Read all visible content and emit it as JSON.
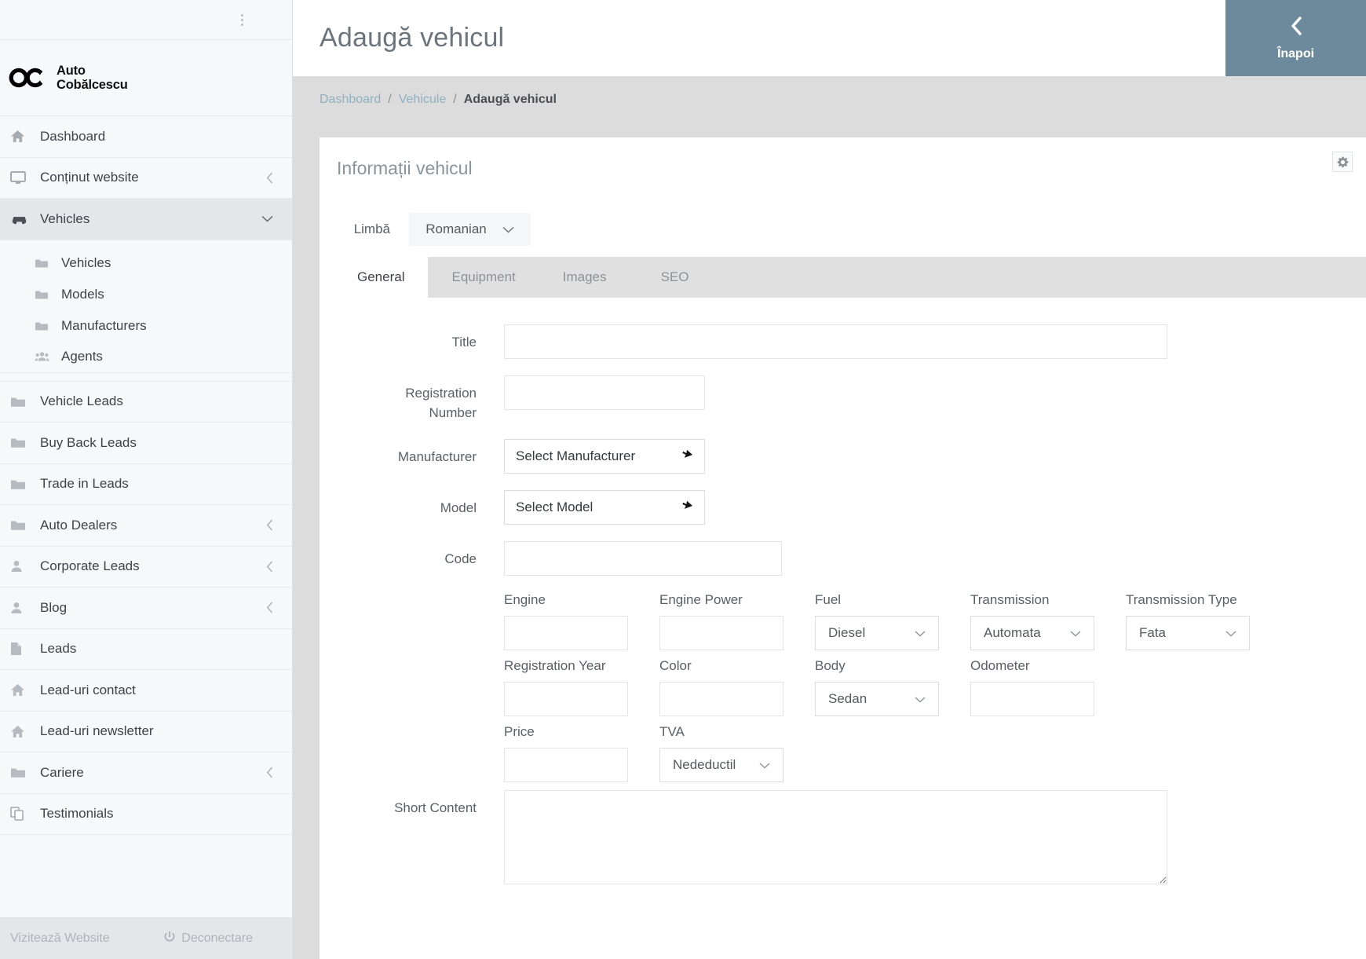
{
  "brand": {
    "line1": "Auto",
    "line2": "Cobălcescu",
    "logo_icon": "ac-monogram-logo"
  },
  "sidebar": {
    "kebab_icon": "kebab-menu-icon",
    "items": [
      {
        "label": "Dashboard",
        "icon": "home-icon",
        "caret": "",
        "active": false
      },
      {
        "label": "Conținut website",
        "icon": "monitor-icon",
        "caret": "‹",
        "active": false
      },
      {
        "label": "Vehicles",
        "icon": "car-icon",
        "caret": "⌄",
        "active": true
      },
      {
        "label": "Vehicle Leads",
        "icon": "folder-icon",
        "caret": "",
        "active": false
      },
      {
        "label": "Buy Back Leads",
        "icon": "folder-icon",
        "caret": "",
        "active": false
      },
      {
        "label": "Trade in Leads",
        "icon": "folder-icon",
        "caret": "",
        "active": false
      },
      {
        "label": "Auto Dealers",
        "icon": "folder-icon",
        "caret": "‹",
        "active": false
      },
      {
        "label": "Corporate Leads",
        "icon": "user-icon",
        "caret": "‹",
        "active": false
      },
      {
        "label": "Blog",
        "icon": "user-icon",
        "caret": "‹",
        "active": false
      },
      {
        "label": "Leads",
        "icon": "file-icon",
        "caret": "",
        "active": false
      },
      {
        "label": "Lead-uri contact",
        "icon": "home-icon",
        "caret": "",
        "active": false
      },
      {
        "label": "Lead-uri newsletter",
        "icon": "home-icon",
        "caret": "",
        "active": false
      },
      {
        "label": "Cariere",
        "icon": "folder-icon",
        "caret": "‹",
        "active": false
      },
      {
        "label": "Testimonials",
        "icon": "copy-icon",
        "caret": "",
        "active": false
      }
    ],
    "subitems": [
      {
        "label": "Vehicles",
        "icon": "folder-icon"
      },
      {
        "label": "Models",
        "icon": "folder-icon"
      },
      {
        "label": "Manufacturers",
        "icon": "folder-icon"
      },
      {
        "label": "Agents",
        "icon": "users-icon"
      }
    ],
    "footer": {
      "visit_site": "Vizitează Website",
      "logout": "Deconectare",
      "logout_icon": "power-icon"
    }
  },
  "header": {
    "title": "Adaugă vehicul",
    "back_label": "Înapoi",
    "back_icon": "chevron-left-icon",
    "back_color": "#6c8a9c"
  },
  "breadcrumb": {
    "items": [
      "Dashboard",
      "Vehicule",
      "Adaugă vehicul"
    ],
    "separator": "/"
  },
  "card": {
    "title": "Informații vehicul",
    "gear_icon": "gear-icon",
    "language": {
      "label": "Limbă",
      "value": "Romanian",
      "chevron_icon": "chevron-down-icon"
    },
    "tabs": [
      {
        "label": "General",
        "active": true
      },
      {
        "label": "Equipment",
        "active": false
      },
      {
        "label": "Images",
        "active": false
      },
      {
        "label": "SEO",
        "active": false
      }
    ]
  },
  "form": {
    "title": {
      "label": "Title",
      "value": "",
      "placeholder": ""
    },
    "registration_number": {
      "label": "Registration\nNumber",
      "label_l1": "Registration",
      "label_l2": "Number",
      "value": "",
      "placeholder": ""
    },
    "manufacturer": {
      "label": "Manufacturer",
      "value": "Select Manufacturer",
      "arrow_icon": "dropdown-arrow-icon"
    },
    "model": {
      "label": "Model",
      "value": "Select Model",
      "arrow_icon": "dropdown-arrow-icon"
    },
    "code": {
      "label": "Code",
      "value": "",
      "placeholder": ""
    },
    "row_specs": [
      {
        "label": "Engine",
        "type": "input",
        "value": ""
      },
      {
        "label": "Engine Power",
        "type": "input",
        "value": ""
      },
      {
        "label": "Fuel",
        "type": "select",
        "value": "Diesel"
      },
      {
        "label": "Transmission",
        "type": "select",
        "value": "Automata"
      },
      {
        "label": "Transmission Type",
        "type": "select",
        "value": "Fata"
      }
    ],
    "row_details": [
      {
        "label": "Registration Year",
        "type": "input",
        "value": ""
      },
      {
        "label": "Color",
        "type": "input",
        "value": ""
      },
      {
        "label": "Body",
        "type": "select",
        "value": "Sedan"
      },
      {
        "label": "Odometer",
        "type": "input",
        "value": ""
      }
    ],
    "row_price": [
      {
        "label": "Price",
        "type": "input",
        "value": ""
      },
      {
        "label": "TVA",
        "type": "select",
        "value": "Nedeductil"
      }
    ],
    "short_content": {
      "label": "Short Content",
      "value": ""
    }
  }
}
